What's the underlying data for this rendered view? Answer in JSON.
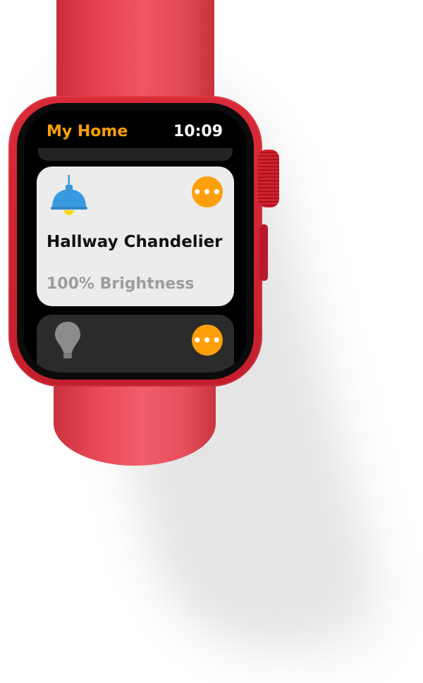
{
  "header": {
    "app_title": "My Home",
    "time": "10:09"
  },
  "accessory_card": {
    "icon": "pendant-lamp-icon",
    "name": "Hallway Chandelier",
    "status": "100% Brightness",
    "more_label": "•••"
  },
  "next_card": {
    "icon": "light-bulb-icon",
    "more_label": "•••"
  },
  "colors": {
    "accent": "#ff9f0a",
    "case": "#d0202e",
    "card": "#ececec",
    "lamp_shade": "#3a9ae0",
    "lamp_bulb": "#ffd60a"
  }
}
